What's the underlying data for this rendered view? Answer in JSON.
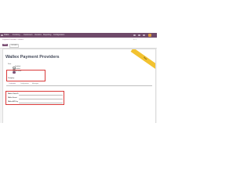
{
  "topbar": {
    "brand": "Odoo",
    "menu": [
      "Invoicing",
      "Customers",
      "Vendors",
      "Reporting",
      "Configuration"
    ]
  },
  "subbar": {
    "breadcrumb": "Payment Providers / Wallex",
    "save_label": "SAVE",
    "discard_label": "DISCARD",
    "pager": "1 / 1"
  },
  "sheet": {
    "title": "Wallex Payment Providers",
    "ribbon": "Test",
    "state_label": "State",
    "state_options": [
      {
        "label": "Disabled",
        "checked": false
      },
      {
        "label": "Enabled",
        "checked": false
      },
      {
        "label": "Test Mode",
        "checked": true
      }
    ],
    "company_label": "Company",
    "tabs": [
      "Credentials",
      "Configuration",
      "Messages"
    ],
    "active_tab": 0,
    "credentials": [
      {
        "label": "Wallex Client ID"
      },
      {
        "label": "Wallex Secret"
      },
      {
        "label": "Wallex API Key"
      }
    ]
  },
  "colors": {
    "topbar": "#6f4a6a",
    "accent": "#7c5176",
    "highlight": "#d93a3a",
    "ribbon": "#f2c230"
  }
}
